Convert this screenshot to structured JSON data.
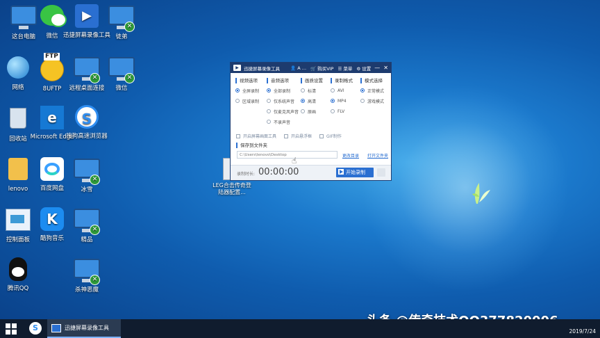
{
  "desktop_icons": [
    {
      "label": "这台电脑",
      "icon": "computer-icon"
    },
    {
      "label": "微信",
      "icon": "wechat-icon"
    },
    {
      "label": "迅捷屏幕录像工具",
      "icon": "screen-recorder-icon"
    },
    {
      "label": "徒弟",
      "icon": "remote-desktop-icon"
    },
    {
      "label": "网络",
      "icon": "network-icon"
    },
    {
      "label": "8UFTP",
      "icon": "ftp-icon",
      "badge_text": "FTP"
    },
    {
      "label": "远程桌面连接",
      "icon": "remote-desktop-icon"
    },
    {
      "label": "微信",
      "icon": "remote-desktop-icon"
    },
    {
      "label": "回收站",
      "icon": "recycle-bin-icon"
    },
    {
      "label": "Microsoft Edge",
      "icon": "edge-icon"
    },
    {
      "label": "搜狗高速浏览器",
      "icon": "sogou-browser-icon"
    },
    {
      "label": "lenovo",
      "icon": "user-folder-icon"
    },
    {
      "label": "百度网盘",
      "icon": "baidu-netdisk-icon"
    },
    {
      "label": "冰雪",
      "icon": "remote-desktop-icon"
    },
    {
      "label": "控制面板",
      "icon": "control-panel-icon"
    },
    {
      "label": "酷狗音乐",
      "icon": "kugou-icon"
    },
    {
      "label": "精品",
      "icon": "remote-desktop-icon"
    },
    {
      "label": "腾讯QQ",
      "icon": "qq-icon"
    },
    {
      "label": "杀神恶魔",
      "icon": "remote-desktop-icon"
    }
  ],
  "desktop_file": {
    "label": "LEG合击传奇登陆器配置..."
  },
  "app": {
    "title": "迅捷屏幕录像工具",
    "user": "A ...",
    "buy_vip": "购买VIP",
    "menu": "菜单",
    "settings": "设置",
    "columns": [
      {
        "head": "视频选项",
        "options": [
          {
            "label": "全屏录制",
            "on": true
          },
          {
            "label": "区域录制",
            "on": false
          }
        ]
      },
      {
        "head": "音频选项",
        "options": [
          {
            "label": "全部录制",
            "on": true
          },
          {
            "label": "仅系统声音",
            "on": false
          },
          {
            "label": "仅麦克风声音",
            "on": false
          },
          {
            "label": "不录声音",
            "on": false
          }
        ]
      },
      {
        "head": "画质设置",
        "options": [
          {
            "label": "标清",
            "on": false
          },
          {
            "label": "高清",
            "on": true
          },
          {
            "label": "原画",
            "on": false
          }
        ]
      },
      {
        "head": "录制格式",
        "options": [
          {
            "label": "AVI",
            "on": false
          },
          {
            "label": "MP4",
            "on": true
          },
          {
            "label": "FLV",
            "on": false
          }
        ]
      },
      {
        "head": "模式选择",
        "options": [
          {
            "label": "正常模式",
            "on": true
          },
          {
            "label": "游戏模式",
            "on": false
          }
        ]
      }
    ],
    "checkboxes": [
      "开启屏幕画面工具",
      "开启悬浮框",
      "GIF制作"
    ],
    "save_head": "保存到文件夹",
    "path_value": "C:\\Users\\lenovo\\Desktop",
    "change_dir": "更改目录",
    "open_folder": "打开文件夹",
    "record_time_label": "录制时长:",
    "record_time": "00:00:00",
    "start_label": "开始录制"
  },
  "watermark": "头条 @传奇技术QQ377820006",
  "taskbar": {
    "app_label": "迅捷屏幕录像工具",
    "time": "",
    "date": "2019/7/24"
  }
}
